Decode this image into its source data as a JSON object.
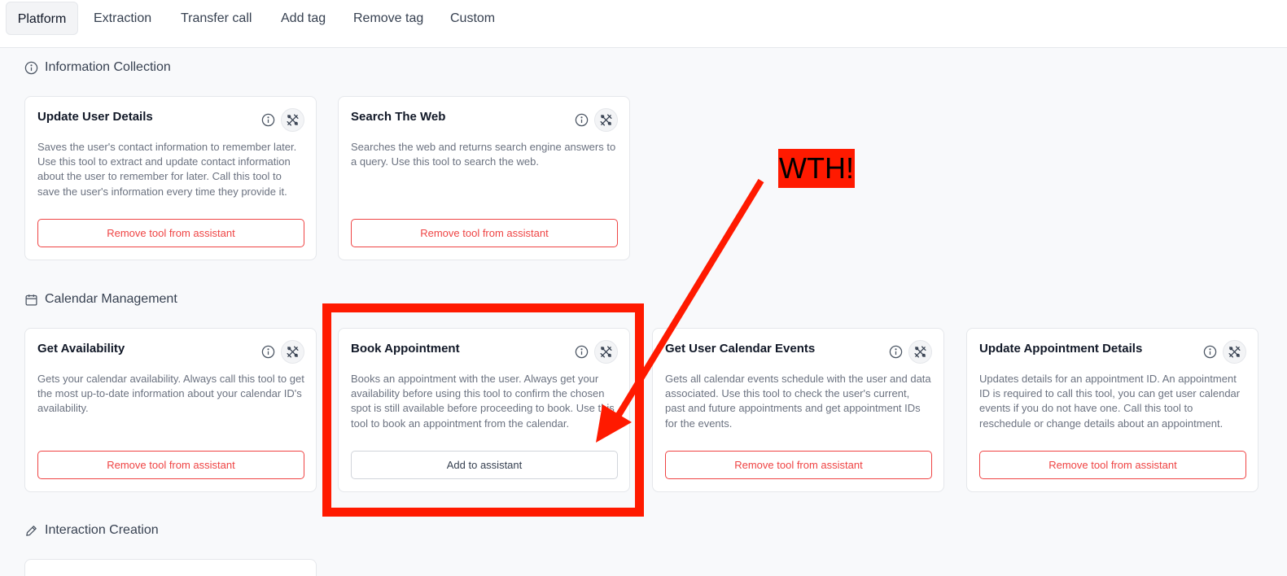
{
  "tabs": [
    {
      "label": "Platform"
    },
    {
      "label": "Extraction"
    },
    {
      "label": "Transfer call"
    },
    {
      "label": "Add tag"
    },
    {
      "label": "Remove tag"
    },
    {
      "label": "Custom"
    }
  ],
  "sections": [
    {
      "title": "Information Collection",
      "icon": "info-icon",
      "cards": [
        {
          "title": "Update User Details",
          "description": "Saves the user's contact information to remember later. Use this tool to extract and update contact information about the user to remember for later. Call this tool to save the user's information every time they provide it.",
          "button": "Remove tool from assistant"
        },
        {
          "title": "Search The Web",
          "description": "Searches the web and returns search engine answers to a query. Use this tool to search the web.",
          "button": "Remove tool from assistant"
        }
      ]
    },
    {
      "title": "Calendar Management",
      "icon": "calendar-icon",
      "cards": [
        {
          "title": "Get Availability",
          "description": "Gets your calendar availability. Always call this tool to get the most up-to-date information about your calendar ID's availability.",
          "button": "Remove tool from assistant"
        },
        {
          "title": "Book Appointment",
          "description": "Books an appointment with the user. Always get your availability before using this tool to confirm the chosen spot is still available before proceeding to book. Use this tool to book an appointment from the calendar.",
          "button": "Add to assistant"
        },
        {
          "title": "Get User Calendar Events",
          "description": "Gets all calendar events schedule with the user and data associated. Use this tool to check the user's current, past and future appointments and get appointment IDs for the events.",
          "button": "Remove tool from assistant"
        },
        {
          "title": "Update Appointment Details",
          "description": "Updates details for an appointment ID. An appointment ID is required to call this tool, you can get user calendar events if you do not have one. Call this tool to reschedule or change details about an appointment.",
          "button": "Remove tool from assistant"
        }
      ]
    },
    {
      "title": "Interaction Creation",
      "icon": "pencil-icon",
      "cards": []
    }
  ],
  "annotation": {
    "label": "WTH!",
    "color": "#ff1a00"
  },
  "colors": {
    "danger": "#ef4444",
    "annotation": "#ff1a00"
  }
}
